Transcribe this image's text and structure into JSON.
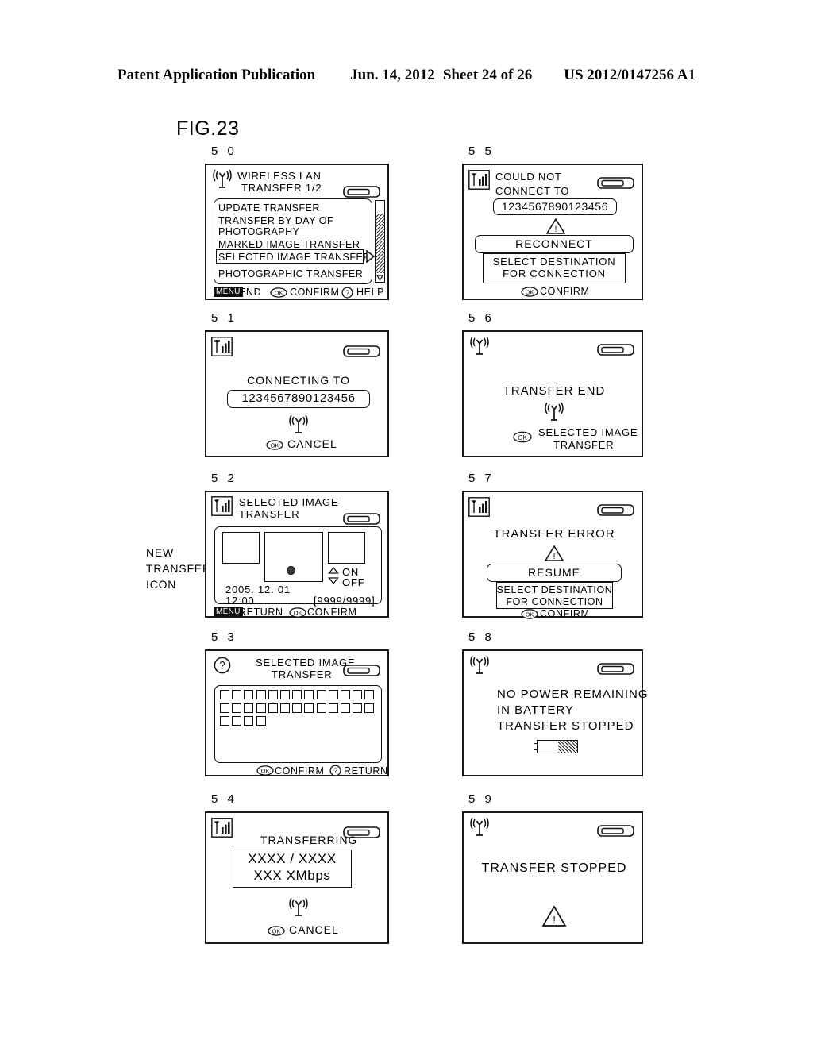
{
  "header": {
    "publication": "Patent Application Publication",
    "date": "Jun. 14, 2012",
    "sheet": "Sheet 24 of 26",
    "patent_number": "US 2012/0147256 A1"
  },
  "figure": {
    "label": "FIG.23",
    "callout": "NEW\nTRANSFER\nICON"
  },
  "screens": {
    "s50": {
      "number": "5 0",
      "icon": "wireless-signal-icon",
      "title_line1": "WIRELESS LAN",
      "title_line2": "TRANSFER 1/2",
      "battery": "battery-icon",
      "menu_items": [
        "UPDATE TRANSFER",
        "TRANSFER BY DAY OF",
        "PHOTOGRAPHY",
        "MARKED IMAGE TRANSFER",
        "SELECTED IMAGE TRANSFER",
        "PHOTOGRAPHIC TRANSFER"
      ],
      "selected_item": "SELECTED IMAGE TRANSFER",
      "footer": {
        "menu_badge": "MENU",
        "menu_action": "END",
        "ok_action": "CONFIRM",
        "help_action": "HELP"
      }
    },
    "s51": {
      "number": "5 1",
      "icon": "signal-bars-icon",
      "battery": "battery-icon",
      "message": "CONNECTING TO",
      "destination": "1234567890123456",
      "center_icon": "wireless-signal-icon",
      "ok_action": "CANCEL"
    },
    "s52": {
      "number": "5 2",
      "icon": "signal-bars-icon",
      "title_line1": "SELECTED IMAGE",
      "title_line2": "TRANSFER",
      "battery": "battery-icon",
      "toggle_on": "ON",
      "toggle_off": "OFF",
      "date": "2005. 12. 01",
      "time": "12:00",
      "counter": "[9999/9999]",
      "footer": {
        "menu_badge": "MENU",
        "menu_action": "RETURN",
        "ok_action": "CONFIRM"
      }
    },
    "s53": {
      "number": "5 3",
      "icon": "help-question-icon",
      "title_line1": "SELECTED IMAGE",
      "title_line2": "TRANSFER",
      "battery": "battery-icon",
      "checkbox_rows": [
        13,
        13,
        4
      ],
      "footer": {
        "ok_action": "CONFIRM",
        "help_action": "RETURN"
      }
    },
    "s54": {
      "number": "5 4",
      "icon": "signal-bars-icon",
      "battery": "battery-icon",
      "title": "TRANSFERRING",
      "progress": "XXXX / XXXX",
      "rate": "XXX XMbps",
      "center_icon": "wireless-signal-icon",
      "ok_action": "CANCEL"
    },
    "s55": {
      "number": "5 5",
      "icon": "signal-bars-icon",
      "battery": "battery-icon",
      "message_line1": "COULD NOT",
      "message_line2": "CONNECT TO",
      "destination": "1234567890123456",
      "warning_icon": "warning-triangle-icon",
      "primary_button": "RECONNECT",
      "secondary_line1": "SELECT DESTINATION",
      "secondary_line2": "FOR CONNECTION",
      "ok_action": "CONFIRM"
    },
    "s56": {
      "number": "5 6",
      "icon": "wireless-signal-icon",
      "battery": "battery-icon",
      "message": "TRANSFER END",
      "center_icon": "wireless-signal-icon",
      "detail_line1": "SELECTED IMAGE",
      "detail_line2": "TRANSFER",
      "ok_label": "OK"
    },
    "s57": {
      "number": "5 7",
      "icon": "signal-bars-icon",
      "battery": "battery-icon",
      "message": "TRANSFER ERROR",
      "warning_icon": "warning-triangle-icon",
      "primary_button": "RESUME",
      "secondary_line1": "SELECT DESTINATION",
      "secondary_line2": "FOR CONNECTION",
      "ok_action": "CONFIRM"
    },
    "s58": {
      "number": "5 8",
      "icon": "wireless-signal-icon",
      "battery": "battery-icon",
      "message_line1": "NO POWER REMAINING",
      "message_line2": "IN BATTERY",
      "message_line3": "TRANSFER STOPPED",
      "battery_low_icon": "battery-low-icon"
    },
    "s59": {
      "number": "5 9",
      "icon": "wireless-signal-icon",
      "battery": "battery-icon",
      "message": "TRANSFER STOPPED",
      "warning_icon": "warning-triangle-icon"
    }
  }
}
